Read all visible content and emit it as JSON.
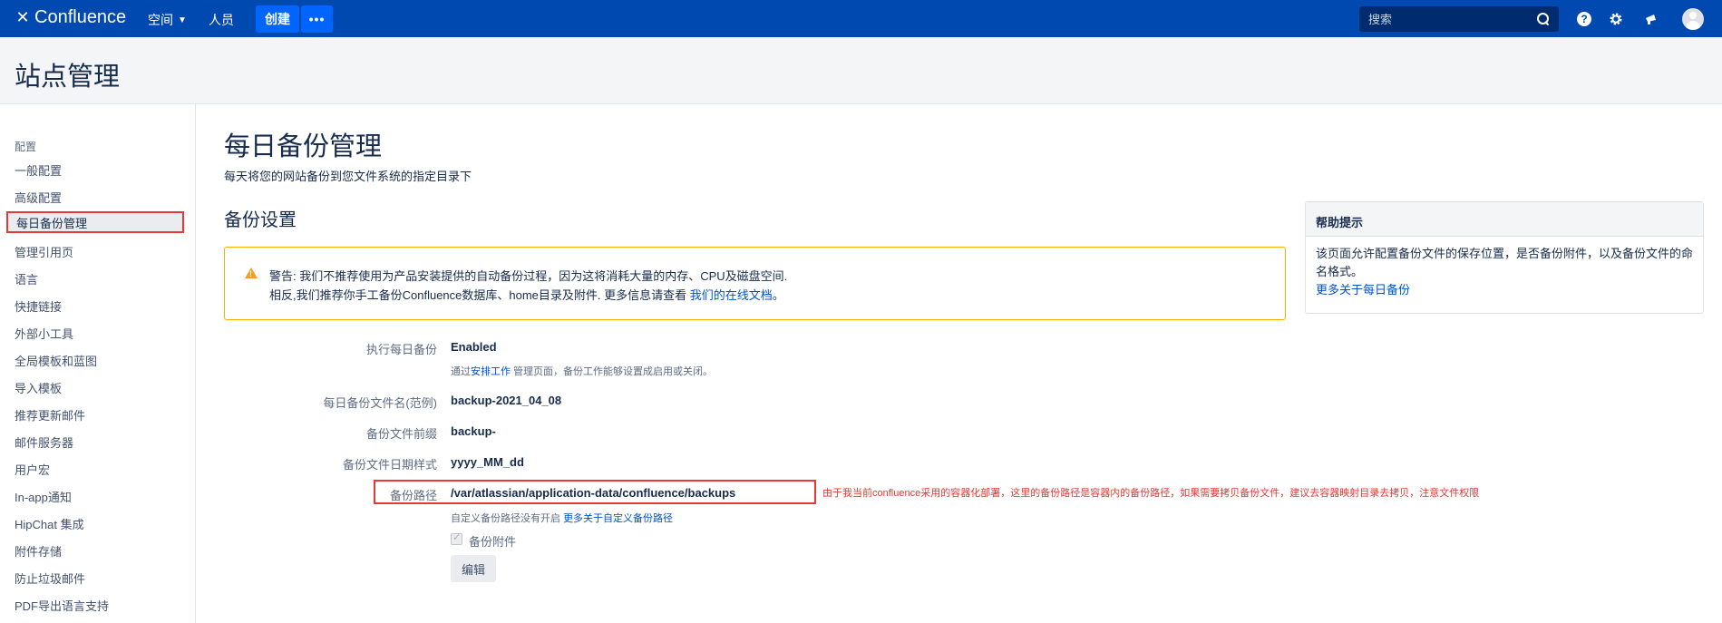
{
  "topnav": {
    "logo_text": "Confluence",
    "spaces_label": "空间",
    "people_label": "人员",
    "create_label": "创建",
    "more_label": "•••",
    "search_placeholder": "搜索",
    "help_icon_char": "?"
  },
  "header": {
    "title": "站点管理"
  },
  "sidebar": {
    "section": "配置",
    "items": [
      {
        "label": "一般配置"
      },
      {
        "label": "高级配置"
      },
      {
        "label": "每日备份管理"
      },
      {
        "label": "管理引用页"
      },
      {
        "label": "语言"
      },
      {
        "label": "快捷链接"
      },
      {
        "label": "外部小工具"
      },
      {
        "label": "全局模板和蓝图"
      },
      {
        "label": "导入模板"
      },
      {
        "label": "推荐更新邮件"
      },
      {
        "label": "邮件服务器"
      },
      {
        "label": "用户宏"
      },
      {
        "label": "In-app通知"
      },
      {
        "label": "HipChat 集成"
      },
      {
        "label": "附件存储"
      },
      {
        "label": "防止垃圾邮件"
      },
      {
        "label": "PDF导出语言支持"
      }
    ]
  },
  "main": {
    "title": "每日备份管理",
    "subtitle": "每天将您的网站备份到您文件系统的指定目录下",
    "section_title": "备份设置",
    "warning": {
      "line1": "警告: 我们不推荐使用为产品安装提供的自动备份过程，因为这将消耗大量的内存、CPU及磁盘空间.",
      "line2_prefix": "相反,我们推荐你手工备份Confluence数据库、home目录及附件. 更多信息请查看 ",
      "line2_link": "我们的在线文档",
      "line2_suffix": "。"
    },
    "rows": {
      "daily_backup_label": "执行每日备份",
      "daily_backup_value": "Enabled",
      "daily_backup_note_prefix": "通过",
      "daily_backup_note_link": "安排工作",
      "daily_backup_note_suffix": " 管理页面，备份工作能够设置成启用或关闭。",
      "filename_label": "每日备份文件名(范例)",
      "filename_value": "backup-2021_04_08",
      "prefix_label": "备份文件前缀",
      "prefix_value": "backup-",
      "date_label": "备份文件日期样式",
      "date_value": "yyyy_MM_dd",
      "path_label": "备份路径",
      "path_value": "/var/atlassian/application-data/confluence/backups",
      "path_note_prefix": "自定义备份路径没有开启 ",
      "path_note_link": "更多关于自定义备份路径",
      "attachments_label": "备份附件",
      "edit_button": "编辑"
    },
    "annotation": "由于我当前confluence采用的容器化部署，这里的备份路径是容器内的备份路径，如果需要拷贝备份文件，建议去容器映射目录去拷贝，注意文件权限"
  },
  "help_panel": {
    "title": "帮助提示",
    "body": "该页面允许配置备份文件的保存位置，是否备份附件，以及备份文件的命名格式。",
    "link": "更多关于每日备份"
  },
  "colors": {
    "nav_bg": "#0049b0",
    "accent": "#0065ff",
    "annotation_red": "#e53935",
    "warning_border": "#ffab00"
  }
}
